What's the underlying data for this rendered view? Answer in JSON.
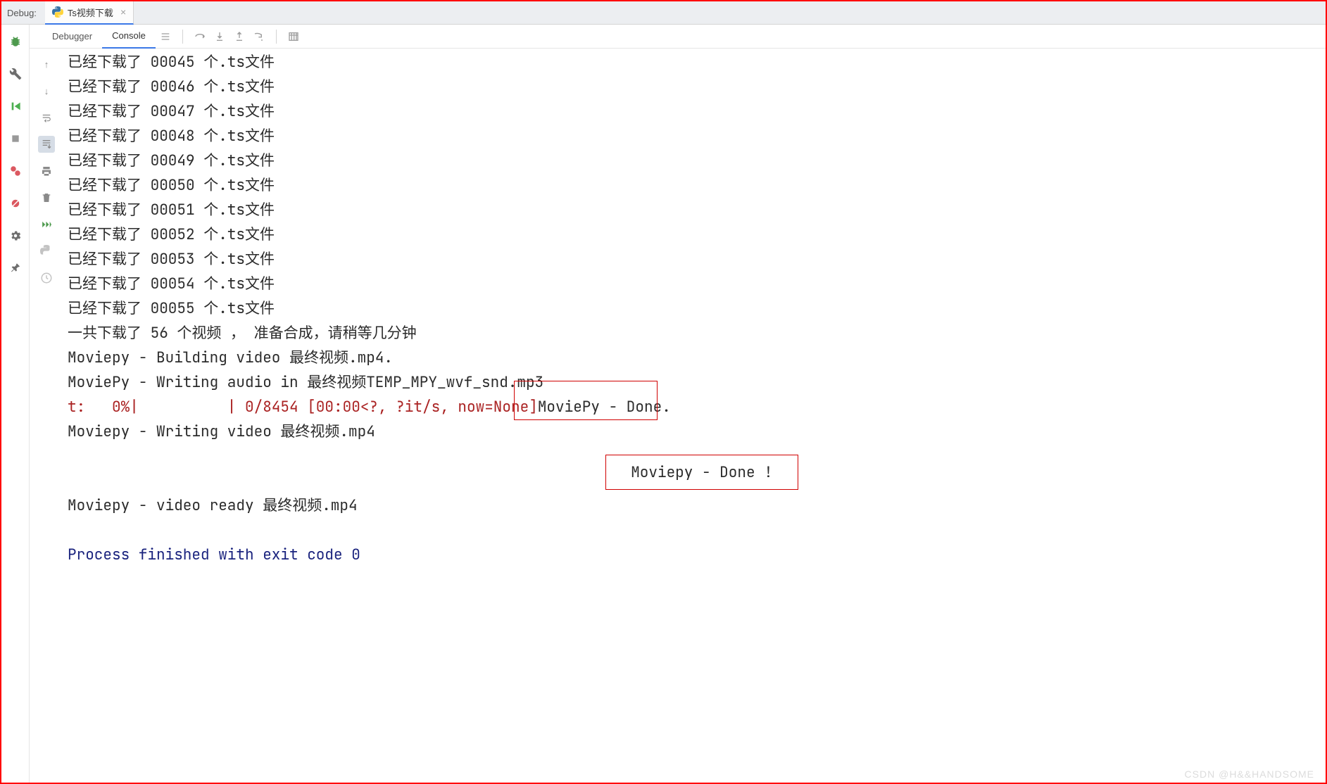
{
  "header": {
    "label": "Debug:",
    "tab": {
      "title": "Ts视频下载"
    }
  },
  "subtabs": {
    "debugger": "Debugger",
    "console": "Console"
  },
  "console_lines": [
    {
      "t": "已经下载了 00045 个.ts文件",
      "cls": ""
    },
    {
      "t": "已经下载了 00046 个.ts文件",
      "cls": ""
    },
    {
      "t": "已经下载了 00047 个.ts文件",
      "cls": ""
    },
    {
      "t": "已经下载了 00048 个.ts文件",
      "cls": ""
    },
    {
      "t": "已经下载了 00049 个.ts文件",
      "cls": ""
    },
    {
      "t": "已经下载了 00050 个.ts文件",
      "cls": ""
    },
    {
      "t": "已经下载了 00051 个.ts文件",
      "cls": ""
    },
    {
      "t": "已经下载了 00052 个.ts文件",
      "cls": ""
    },
    {
      "t": "已经下载了 00053 个.ts文件",
      "cls": ""
    },
    {
      "t": "已经下载了 00054 个.ts文件",
      "cls": ""
    },
    {
      "t": "已经下载了 00055 个.ts文件",
      "cls": ""
    },
    {
      "t": "一共下载了 56 个视频 ， 准备合成，请稍等几分钟",
      "cls": ""
    },
    {
      "t": "Moviepy - Building video 最终视频.mp4.",
      "cls": ""
    },
    {
      "t": "MoviePy - Writing audio in 最终视频TEMP_MPY_wvf_snd.mp3",
      "cls": ""
    },
    {
      "segments": [
        {
          "t": "t:   0%|          | 0/8454 [00:00<?, ?it/s, now=None]",
          "cls": "red"
        },
        {
          "t": "MoviePy - Done.",
          "cls": ""
        }
      ]
    },
    {
      "t": "Moviepy - Writing video 最终视频.mp4",
      "cls": ""
    },
    {
      "t": "",
      "cls": ""
    },
    {
      "t": "",
      "cls": ""
    },
    {
      "t": "Moviepy - video ready 最终视频.mp4",
      "cls": ""
    },
    {
      "t": "",
      "cls": ""
    },
    {
      "t": "Process finished with exit code 0",
      "cls": "blue"
    }
  ],
  "overlay_done": "Moviepy - Done !",
  "watermark": "CSDN @H&&HANDSOME"
}
